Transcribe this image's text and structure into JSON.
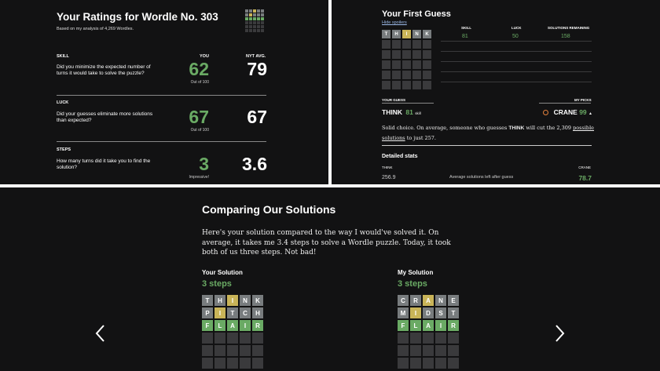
{
  "ratings": {
    "title": "Your Ratings for Wordle No. 303",
    "subtitle": "Based on my analysis of 4,269 Wordles.",
    "col_you": "YOU",
    "col_nyt": "NYT AVG.",
    "skill": {
      "label": "SKILL",
      "desc": "Did you minimize the expected number of turns it would take to solve the puzzle?",
      "you": "62",
      "note": "Out of 100",
      "nyt": "79"
    },
    "luck": {
      "label": "LUCK",
      "desc": "Did your guesses eliminate more solutions than expected?",
      "you": "67",
      "note": "Out of 100",
      "nyt": "67"
    },
    "steps": {
      "label": "STEPS",
      "desc": "How many turns did it take you to find the solution?",
      "you": "3",
      "note": "Impressive!",
      "nyt": "3.6"
    }
  },
  "first_guess": {
    "title": "Your First Guess",
    "hide_spoilers": "Hide spoilers",
    "letters": [
      "T",
      "H",
      "I",
      "N",
      "K"
    ],
    "col_skill": "SKILL",
    "col_luck": "LUCK",
    "col_remaining": "SOLUTIONS REMAINING",
    "skill": "81",
    "luck": "50",
    "remaining": "158",
    "your_guess_label": "YOUR GUESS",
    "my_picks_label": "MY PICKS",
    "guess_word": "THINK",
    "guess_score": "81",
    "guess_score_suffix": "skill",
    "pick_word": "CRANE",
    "pick_score": "99",
    "para_1": "Solid choice. On average, someone who guesses ",
    "para_word": "THINK",
    "para_2": " will cut the 2,309 ",
    "para_link": "possible solutions",
    "para_3": " to just 257.",
    "detailed": "Detailed stats",
    "left_word": "THINK",
    "right_word": "CRANE",
    "left_val": "256.9",
    "mid_label": "Average solutions left after guess",
    "right_val": "78.7"
  },
  "comparison": {
    "title": "Comparing Our Solutions",
    "text": "Here's your solution compared to the way I would've solved it. On average, it takes me 3.4 steps to solve a Wordle puzzle. Today, it took both of us three steps. Not bad!",
    "yours_label": "Your Solution",
    "yours_steps": "3 steps",
    "mine_label": "My Solution",
    "mine_steps": "3 steps",
    "your_rows": [
      [
        "T",
        "H",
        "I",
        "N",
        "K"
      ],
      [
        "P",
        "I",
        "T",
        "C",
        "H"
      ],
      [
        "F",
        "L",
        "A",
        "I",
        "R"
      ]
    ],
    "my_rows": [
      [
        "C",
        "R",
        "A",
        "N",
        "E"
      ],
      [
        "M",
        "I",
        "D",
        "S",
        "T"
      ],
      [
        "F",
        "L",
        "A",
        "I",
        "R"
      ]
    ],
    "prev_icon": "chevron-left-icon",
    "next_icon": "chevron-right-icon"
  },
  "colors": {
    "green": "#6aaa64",
    "yellow": "#c9b458",
    "gray": "#787c7e",
    "empty": "#3a3a3c",
    "bg": "#121213"
  }
}
